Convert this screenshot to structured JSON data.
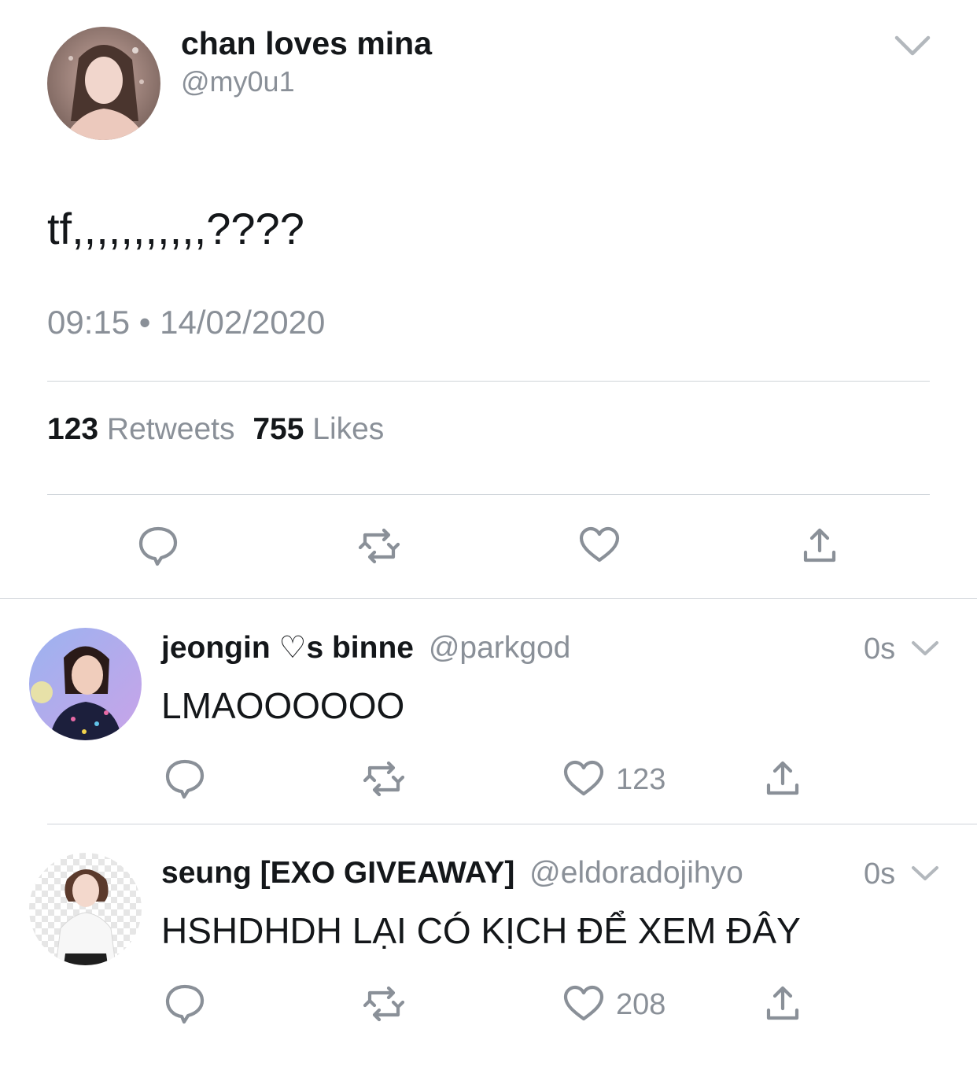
{
  "tweet": {
    "display_name": "chan loves mina",
    "handle": "@my0u1",
    "text": "tf,,,,,,,,,,,????",
    "time": "09:15",
    "separator": "•",
    "date": "14/02/2020",
    "retweets_count": "123",
    "retweets_label": "Retweets",
    "likes_count": "755",
    "likes_label": "Likes",
    "actions": [
      "reply-icon",
      "retweet-icon",
      "like-icon",
      "share-icon"
    ]
  },
  "replies": [
    {
      "display_name": "jeongin ♡s binne",
      "handle": "@parkgod",
      "time": "0s",
      "text": "LMAOOOOOO",
      "like_count": "123"
    },
    {
      "display_name": "seung [EXO GIVEAWAY]",
      "handle": "@eldoradojihyo",
      "time": "0s",
      "text": "HSHDHDH LẠI CÓ KỊCH ĐỂ XEM ĐÂY",
      "like_count": "208"
    }
  ],
  "colors": {
    "text": "#14171a",
    "secondary": "#8a9098",
    "divider": "#cfd4d9"
  }
}
